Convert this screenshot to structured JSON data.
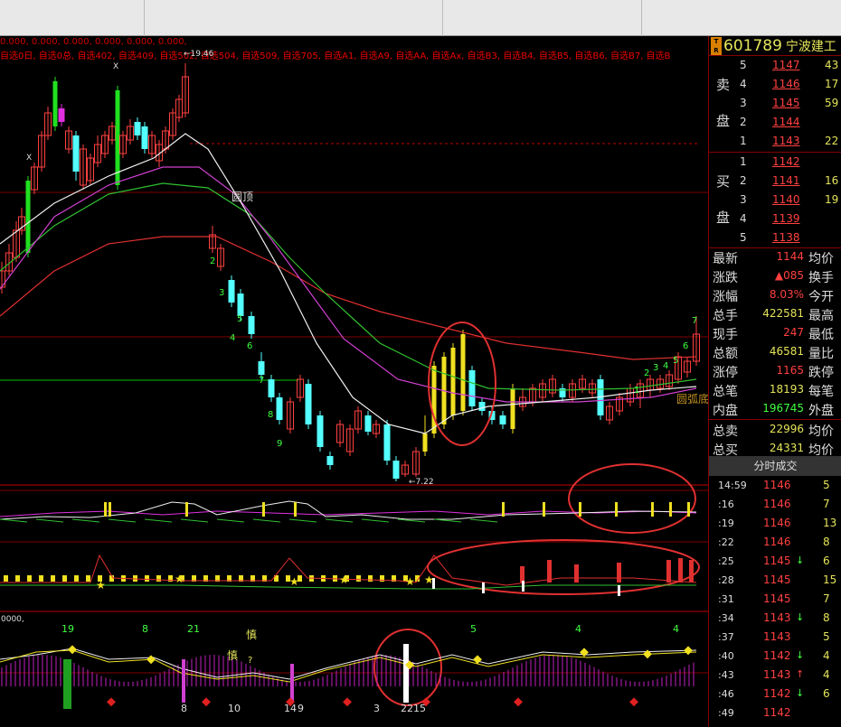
{
  "indicator_values": "0.000, 0.000, 0.000, 0.000, 0.000, 0.000,",
  "watchlist": "自选0日, 自选0总, 自选402, 自选409, 自选502, 自选504, 自选509, 自选705, 自选A1, 自选A9, 自选AA, 自选Ax, 自选B3, 自选B4, 自选B5, 自选B6, 自选B7, 自选B",
  "chart_labels": {
    "peak": "←19.46",
    "trough": "←7.22",
    "round_top": "圆顶",
    "round_bottom": "圆弧底",
    "x1": "X",
    "x2": "X",
    "counts_left": [
      "2",
      "3",
      "5",
      "4",
      "6",
      "7",
      "8",
      "9"
    ],
    "counts_right": [
      "1",
      "2",
      "3",
      "4",
      "5",
      "6",
      "7"
    ],
    "mid_axis": "0000,",
    "bot_nums_top": [
      "19",
      "8",
      "21",
      "5",
      "4",
      "4"
    ],
    "bot_nums_bottom": [
      "8",
      "10",
      "14",
      "9",
      "3",
      "2215"
    ],
    "shen": "慎",
    "shen2": "慎",
    "q": "?",
    "zero": "0"
  },
  "stock": {
    "tr": "T\nR",
    "code": "601789",
    "name": "宁波建工"
  },
  "orderbook": {
    "sell_label": "卖\n\n盘",
    "buy_label": "买\n\n盘",
    "asks": [
      {
        "lvl": "5",
        "price": "1147",
        "vol": "43"
      },
      {
        "lvl": "4",
        "price": "1146",
        "vol": "17"
      },
      {
        "lvl": "3",
        "price": "1145",
        "vol": "59"
      },
      {
        "lvl": "2",
        "price": "1144",
        "vol": ""
      },
      {
        "lvl": "1",
        "price": "1143",
        "vol": "22"
      }
    ],
    "bids": [
      {
        "lvl": "1",
        "price": "1142",
        "vol": ""
      },
      {
        "lvl": "2",
        "price": "1141",
        "vol": "16"
      },
      {
        "lvl": "3",
        "price": "1140",
        "vol": "19"
      },
      {
        "lvl": "4",
        "price": "1139",
        "vol": ""
      },
      {
        "lvl": "5",
        "price": "1138",
        "vol": ""
      }
    ]
  },
  "stats": [
    {
      "k": "最新",
      "v": "1144",
      "color": "#ff4040",
      "k2": "均价"
    },
    {
      "k": "涨跌",
      "v": "▲085",
      "color": "#ff4040",
      "k2": "换手"
    },
    {
      "k": "涨幅",
      "v": "8.03%",
      "color": "#ff4040",
      "k2": "今开"
    },
    {
      "k": "总手",
      "v": "422581",
      "color": "#e4e45a",
      "k2": "最高"
    },
    {
      "k": "现手",
      "v": "247",
      "color": "#ff4040",
      "k2": "最低"
    },
    {
      "k": "总额",
      "v": "46581",
      "color": "#e4e45a",
      "k2": "量比"
    },
    {
      "k": "涨停",
      "v": "1165",
      "color": "#ff4040",
      "k2": "跌停"
    },
    {
      "k": "总笔",
      "v": "18193",
      "color": "#e4e45a",
      "k2": "每笔"
    },
    {
      "k": "内盘",
      "v": "196745",
      "color": "#40ff40",
      "k2": "外盘"
    },
    {
      "k": "总卖",
      "v": "22996",
      "color": "#e4e45a",
      "k2": "均价"
    },
    {
      "k": "总买",
      "v": "24331",
      "color": "#e4e45a",
      "k2": "均价"
    }
  ],
  "trades_header": "分时成交",
  "trades": [
    {
      "t": "14:59",
      "p": "1146",
      "ar": "",
      "arc": "",
      "q": "5"
    },
    {
      "t": ":16",
      "p": "1146",
      "ar": "",
      "arc": "",
      "q": "7"
    },
    {
      "t": ":19",
      "p": "1146",
      "ar": "",
      "arc": "",
      "q": "13"
    },
    {
      "t": ":22",
      "p": "1146",
      "ar": "",
      "arc": "",
      "q": "8"
    },
    {
      "t": ":25",
      "p": "1145",
      "ar": "↓",
      "arc": "#40ff40",
      "q": "6"
    },
    {
      "t": ":28",
      "p": "1145",
      "ar": "",
      "arc": "",
      "q": "15"
    },
    {
      "t": ":31",
      "p": "1145",
      "ar": "",
      "arc": "",
      "q": "7"
    },
    {
      "t": ":34",
      "p": "1143",
      "ar": "↓",
      "arc": "#40ff40",
      "q": "8"
    },
    {
      "t": ":37",
      "p": "1143",
      "ar": "",
      "arc": "",
      "q": "5"
    },
    {
      "t": ":40",
      "p": "1142",
      "ar": "↓",
      "arc": "#40ff40",
      "q": "4"
    },
    {
      "t": ":43",
      "p": "1143",
      "ar": "↑",
      "arc": "#ff4040",
      "q": "4"
    },
    {
      "t": ":46",
      "p": "1142",
      "ar": "↓",
      "arc": "#40ff40",
      "q": "6"
    },
    {
      "t": ":49",
      "p": "1142",
      "ar": "",
      "arc": "",
      "q": ""
    }
  ],
  "colors": {
    "up": "#ff4040",
    "down": "#54ffff",
    "vol_up": "#e4e45a",
    "grid": "#800000"
  }
}
